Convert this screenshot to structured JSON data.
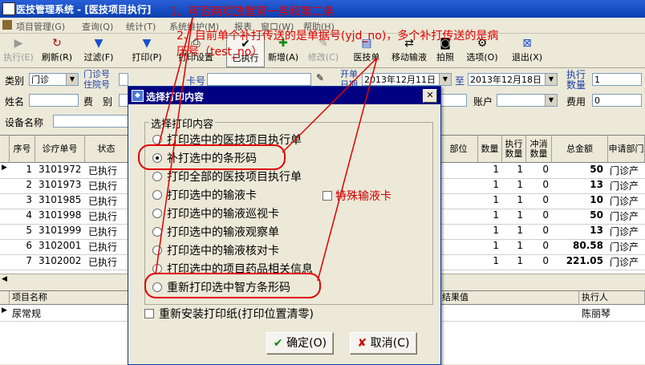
{
  "window": {
    "title": "医技管理系统 - [医技项目执行]"
  },
  "menu": [
    "项目管理(G)",
    "查询(Q)",
    "统计(T)",
    "系统维护(M)",
    "报表",
    "窗口(W)",
    "帮助(H)"
  ],
  "toolbar": [
    {
      "label": "执行(E)",
      "icon": "execute-icon",
      "disabled": true
    },
    {
      "label": "刷新(R)",
      "icon": "refresh-icon"
    },
    {
      "label": "过滤(F)",
      "icon": "filter-icon"
    },
    {
      "label": "打印(P)",
      "icon": "print-icon"
    },
    {
      "label": "打印设置",
      "icon": "print-settings-icon"
    },
    {
      "label": "已执行",
      "icon": "executed-icon",
      "pressed": true
    },
    {
      "label": "新增(A)",
      "icon": "add-icon"
    },
    {
      "label": "修改(C)",
      "icon": "edit-icon",
      "disabled": true
    },
    {
      "label": "医技单",
      "icon": "medtech-form-icon"
    },
    {
      "label": "移动输液",
      "icon": "mobile-infusion-icon"
    },
    {
      "label": "拍照",
      "icon": "camera-icon"
    },
    {
      "label": "选项(O)",
      "icon": "options-icon"
    },
    {
      "label": "退出(X)",
      "icon": "exit-icon"
    }
  ],
  "filters": {
    "category_label": "类别",
    "category_value": "门诊",
    "clinic_label_1": "门诊号",
    "clinic_label_2": "住院号",
    "card_label": "卡号",
    "date_label_1": "开单",
    "date_label_2": "日期",
    "date_from": "2013年12月11日",
    "date_to_label": "至",
    "date_to": "2013年12月18日",
    "exec_qty_label_1": "执行",
    "exec_qty_label_2": "数量",
    "exec_qty": "1",
    "name_label": "姓名",
    "fee_label": "费　别",
    "account_label": "账户",
    "cost_label": "费用",
    "cost": "0",
    "device_label": "设备名称"
  },
  "grid": {
    "headers": [
      "序号",
      "诊疗单号",
      "状态",
      "部位",
      "数量",
      "执行数量",
      "冲消数量",
      "总金额",
      "申请部门"
    ],
    "rows": [
      {
        "no": "1",
        "id": "3101972",
        "status": "已执行",
        "qty": "1",
        "exec": "1",
        "cancel": "0",
        "amount": "50",
        "dept": "门诊产"
      },
      {
        "no": "2",
        "id": "3101973",
        "status": "已执行",
        "qty": "1",
        "exec": "1",
        "cancel": "0",
        "amount": "13",
        "dept": "门诊产"
      },
      {
        "no": "3",
        "id": "3101985",
        "status": "已执行",
        "qty": "1",
        "exec": "1",
        "cancel": "0",
        "amount": "10",
        "dept": "门诊产"
      },
      {
        "no": "4",
        "id": "3101998",
        "status": "已执行",
        "qty": "1",
        "exec": "1",
        "cancel": "0",
        "amount": "50",
        "dept": "门诊产"
      },
      {
        "no": "5",
        "id": "3101999",
        "status": "已执行",
        "qty": "1",
        "exec": "1",
        "cancel": "0",
        "amount": "13",
        "dept": "门诊产"
      },
      {
        "no": "6",
        "id": "3102001",
        "status": "已执行",
        "qty": "1",
        "exec": "1",
        "cancel": "0",
        "amount": "80.58",
        "dept": "门诊产"
      },
      {
        "no": "7",
        "id": "3102002",
        "status": "已执行",
        "qty": "1",
        "exec": "1",
        "cancel": "0",
        "amount": "221.05",
        "dept": "门诊产"
      }
    ]
  },
  "detail_grid": {
    "headers": [
      "项目名称",
      "结果值",
      "执行人"
    ],
    "rows": [
      {
        "item": "尿常规",
        "result": "",
        "executor": "陈丽琴"
      }
    ]
  },
  "dialog": {
    "title": "选择打印内容",
    "group_label": "选择打印内容",
    "options": [
      "打印选中的医技项目执行单",
      "补打选中的条形码",
      "打印全部的医技项目执行单",
      "打印选中的输液卡",
      "打印选中的输液巡视卡",
      "打印选中的输液观察单",
      "打印选中的输液核对卡",
      "打印选中的项目药品相关信息",
      "重新打印选中智方条形码"
    ],
    "selected_index": 1,
    "special_infusion_label": "特殊输液卡",
    "reinstall_label": "重新安装打印纸(打印位置清零)",
    "ok_label": "确定(O)",
    "cancel_label": "取消(C)"
  },
  "annotations": {
    "note1": "1、可否两项放置第一条和第二条",
    "note2_line1": "2、目前单个补打传送的是单据号(yjd_no)，多个补打传送的是病",
    "note2_line2": "历号（test_no）"
  }
}
